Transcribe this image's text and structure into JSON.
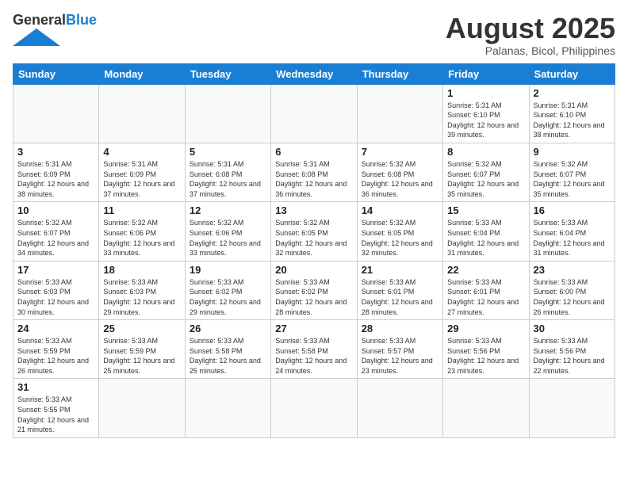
{
  "header": {
    "logo_general": "General",
    "logo_blue": "Blue",
    "title": "August 2025",
    "subtitle": "Palanas, Bicol, Philippines"
  },
  "weekdays": [
    "Sunday",
    "Monday",
    "Tuesday",
    "Wednesday",
    "Thursday",
    "Friday",
    "Saturday"
  ],
  "weeks": [
    [
      {
        "day": "",
        "info": ""
      },
      {
        "day": "",
        "info": ""
      },
      {
        "day": "",
        "info": ""
      },
      {
        "day": "",
        "info": ""
      },
      {
        "day": "",
        "info": ""
      },
      {
        "day": "1",
        "info": "Sunrise: 5:31 AM\nSunset: 6:10 PM\nDaylight: 12 hours\nand 39 minutes."
      },
      {
        "day": "2",
        "info": "Sunrise: 5:31 AM\nSunset: 6:10 PM\nDaylight: 12 hours\nand 38 minutes."
      }
    ],
    [
      {
        "day": "3",
        "info": "Sunrise: 5:31 AM\nSunset: 6:09 PM\nDaylight: 12 hours\nand 38 minutes."
      },
      {
        "day": "4",
        "info": "Sunrise: 5:31 AM\nSunset: 6:09 PM\nDaylight: 12 hours\nand 37 minutes."
      },
      {
        "day": "5",
        "info": "Sunrise: 5:31 AM\nSunset: 6:08 PM\nDaylight: 12 hours\nand 37 minutes."
      },
      {
        "day": "6",
        "info": "Sunrise: 5:31 AM\nSunset: 6:08 PM\nDaylight: 12 hours\nand 36 minutes."
      },
      {
        "day": "7",
        "info": "Sunrise: 5:32 AM\nSunset: 6:08 PM\nDaylight: 12 hours\nand 36 minutes."
      },
      {
        "day": "8",
        "info": "Sunrise: 5:32 AM\nSunset: 6:07 PM\nDaylight: 12 hours\nand 35 minutes."
      },
      {
        "day": "9",
        "info": "Sunrise: 5:32 AM\nSunset: 6:07 PM\nDaylight: 12 hours\nand 35 minutes."
      }
    ],
    [
      {
        "day": "10",
        "info": "Sunrise: 5:32 AM\nSunset: 6:07 PM\nDaylight: 12 hours\nand 34 minutes."
      },
      {
        "day": "11",
        "info": "Sunrise: 5:32 AM\nSunset: 6:06 PM\nDaylight: 12 hours\nand 33 minutes."
      },
      {
        "day": "12",
        "info": "Sunrise: 5:32 AM\nSunset: 6:06 PM\nDaylight: 12 hours\nand 33 minutes."
      },
      {
        "day": "13",
        "info": "Sunrise: 5:32 AM\nSunset: 6:05 PM\nDaylight: 12 hours\nand 32 minutes."
      },
      {
        "day": "14",
        "info": "Sunrise: 5:32 AM\nSunset: 6:05 PM\nDaylight: 12 hours\nand 32 minutes."
      },
      {
        "day": "15",
        "info": "Sunrise: 5:33 AM\nSunset: 6:04 PM\nDaylight: 12 hours\nand 31 minutes."
      },
      {
        "day": "16",
        "info": "Sunrise: 5:33 AM\nSunset: 6:04 PM\nDaylight: 12 hours\nand 31 minutes."
      }
    ],
    [
      {
        "day": "17",
        "info": "Sunrise: 5:33 AM\nSunset: 6:03 PM\nDaylight: 12 hours\nand 30 minutes."
      },
      {
        "day": "18",
        "info": "Sunrise: 5:33 AM\nSunset: 6:03 PM\nDaylight: 12 hours\nand 29 minutes."
      },
      {
        "day": "19",
        "info": "Sunrise: 5:33 AM\nSunset: 6:02 PM\nDaylight: 12 hours\nand 29 minutes."
      },
      {
        "day": "20",
        "info": "Sunrise: 5:33 AM\nSunset: 6:02 PM\nDaylight: 12 hours\nand 28 minutes."
      },
      {
        "day": "21",
        "info": "Sunrise: 5:33 AM\nSunset: 6:01 PM\nDaylight: 12 hours\nand 28 minutes."
      },
      {
        "day": "22",
        "info": "Sunrise: 5:33 AM\nSunset: 6:01 PM\nDaylight: 12 hours\nand 27 minutes."
      },
      {
        "day": "23",
        "info": "Sunrise: 5:33 AM\nSunset: 6:00 PM\nDaylight: 12 hours\nand 26 minutes."
      }
    ],
    [
      {
        "day": "24",
        "info": "Sunrise: 5:33 AM\nSunset: 5:59 PM\nDaylight: 12 hours\nand 26 minutes."
      },
      {
        "day": "25",
        "info": "Sunrise: 5:33 AM\nSunset: 5:59 PM\nDaylight: 12 hours\nand 25 minutes."
      },
      {
        "day": "26",
        "info": "Sunrise: 5:33 AM\nSunset: 5:58 PM\nDaylight: 12 hours\nand 25 minutes."
      },
      {
        "day": "27",
        "info": "Sunrise: 5:33 AM\nSunset: 5:58 PM\nDaylight: 12 hours\nand 24 minutes."
      },
      {
        "day": "28",
        "info": "Sunrise: 5:33 AM\nSunset: 5:57 PM\nDaylight: 12 hours\nand 23 minutes."
      },
      {
        "day": "29",
        "info": "Sunrise: 5:33 AM\nSunset: 5:56 PM\nDaylight: 12 hours\nand 23 minutes."
      },
      {
        "day": "30",
        "info": "Sunrise: 5:33 AM\nSunset: 5:56 PM\nDaylight: 12 hours\nand 22 minutes."
      }
    ],
    [
      {
        "day": "31",
        "info": "Sunrise: 5:33 AM\nSunset: 5:55 PM\nDaylight: 12 hours\nand 21 minutes."
      },
      {
        "day": "",
        "info": ""
      },
      {
        "day": "",
        "info": ""
      },
      {
        "day": "",
        "info": ""
      },
      {
        "day": "",
        "info": ""
      },
      {
        "day": "",
        "info": ""
      },
      {
        "day": "",
        "info": ""
      }
    ]
  ]
}
